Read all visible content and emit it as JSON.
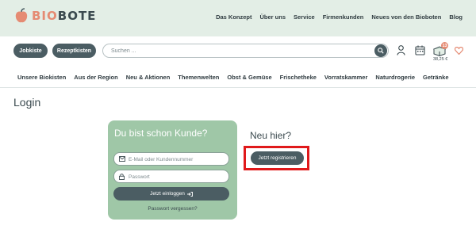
{
  "brand": {
    "part1": "BIO",
    "part2": "BOTE"
  },
  "top_nav": [
    "Das Konzept",
    "Über uns",
    "Service",
    "Firmenkunden",
    "Neues von den Bioboten",
    "Blog"
  ],
  "header_buttons": {
    "jobkiste": "Jobkiste",
    "rezeptkisten": "Rezeptkisten"
  },
  "search": {
    "placeholder": "Suchen ..."
  },
  "cart": {
    "count": "13",
    "total": "38,25 €"
  },
  "categories": [
    "Unsere Biokisten",
    "Aus der Region",
    "Neu & Aktionen",
    "Themenwelten",
    "Obst & Gemüse",
    "Frischetheke",
    "Vorratskammer",
    "Naturdrogerie",
    "Getränke"
  ],
  "page": {
    "title": "Login"
  },
  "login": {
    "title": "Du bist schon Kunde?",
    "email_placeholder": "E-Mail oder Kundennummer",
    "password_placeholder": "Passwort",
    "submit_label": "Jetzt einloggen",
    "forgot_label": "Passwort vergessen?"
  },
  "register": {
    "title": "Neu hier?",
    "button_label": "Jetzt registrieren"
  },
  "colors": {
    "header_bg": "#e3eee6",
    "card_bg": "#9fc7a7",
    "button": "#4b5d63",
    "accent": "#e58b73",
    "highlight": "#e0191b"
  }
}
